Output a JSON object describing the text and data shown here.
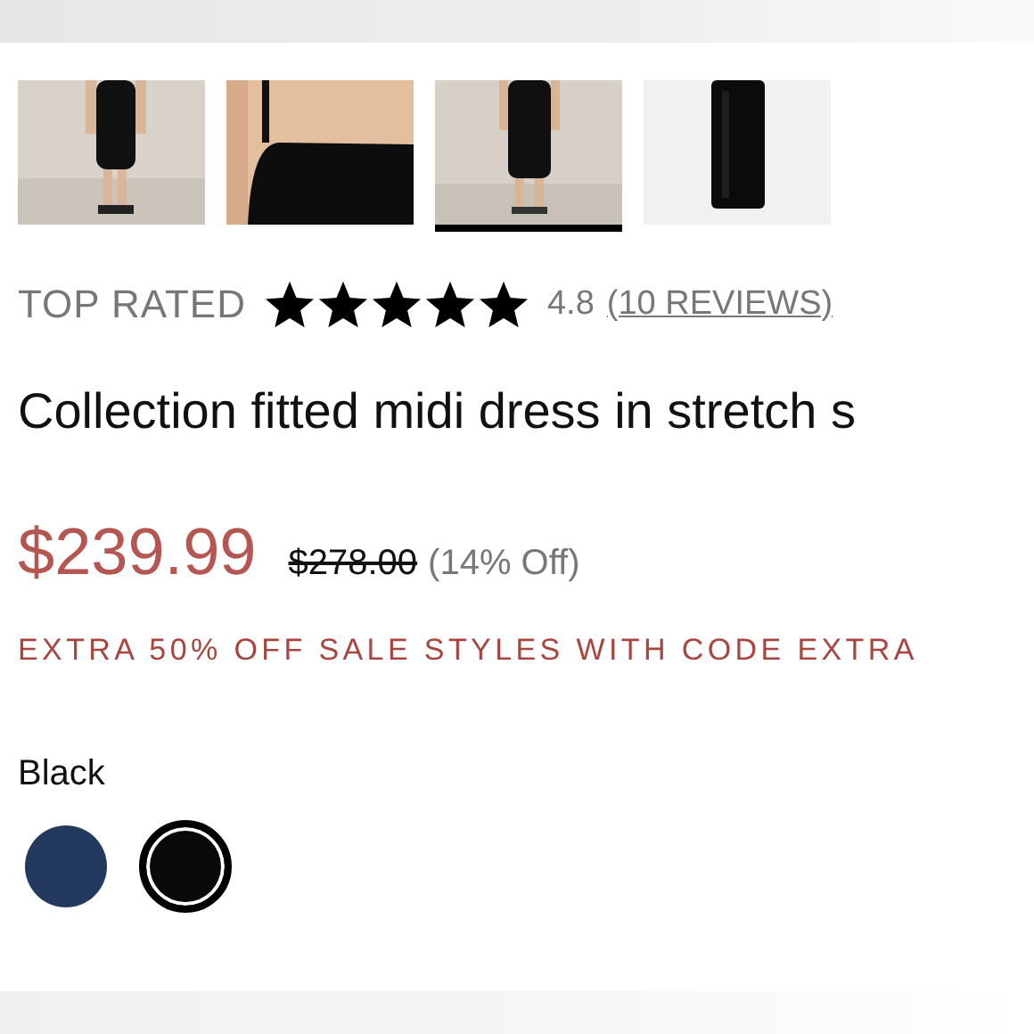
{
  "thumbnails": [
    {
      "kind": "picture",
      "selected": false
    },
    {
      "kind": "picture",
      "selected": false
    },
    {
      "kind": "picture",
      "selected": true
    },
    {
      "kind": "picture",
      "selected": false
    }
  ],
  "rating": {
    "badge": "TOP RATED",
    "stars": 5,
    "score": "4.8",
    "reviews_link": "(10 REVIEWS)"
  },
  "product_title": "Collection fitted midi dress in stretch s",
  "price": {
    "sale": "$239.99",
    "original": "$278.00",
    "discount": "(14% Off)"
  },
  "promo": "EXTRA 50% OFF SALE STYLES WITH CODE EXTRA",
  "color_label": "Black",
  "swatches": [
    {
      "color": "#233a5e",
      "selected": false
    },
    {
      "color": "#0a0a0a",
      "selected": true
    }
  ]
}
